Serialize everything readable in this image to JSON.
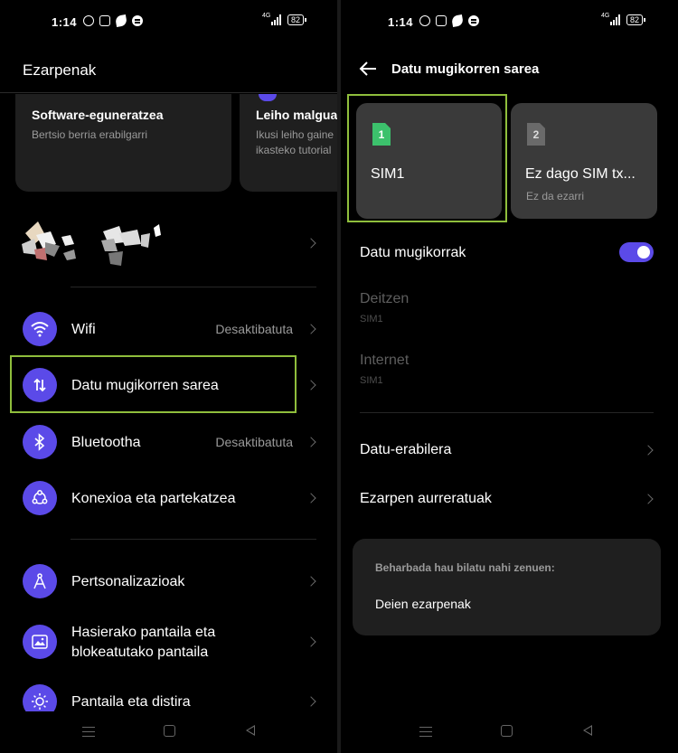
{
  "status": {
    "time": "1:14",
    "network": "4G",
    "battery": "82"
  },
  "left": {
    "title": "Ezarpenak",
    "cards": [
      {
        "title": "Software-eguneratzea",
        "subtitle": "Bertsio berria erabilgarri"
      },
      {
        "title": "Leiho malgual",
        "subtitle": "Ikusi leiho gaine ikasteko tutorial"
      }
    ],
    "items": [
      {
        "label": "Wifi",
        "value": "Desaktibatuta",
        "icon": "wifi-icon"
      },
      {
        "label": "Datu mugikorren sarea",
        "value": "",
        "icon": "data-transfer-icon"
      },
      {
        "label": "Bluetootha",
        "value": "Desaktibatuta",
        "icon": "bluetooth-icon"
      },
      {
        "label": "Konexioa eta partekatzea",
        "value": "",
        "icon": "share-icon"
      },
      {
        "label": "Pertsonalizazioak",
        "value": "",
        "icon": "personalize-icon"
      },
      {
        "label_line1": "Hasierako pantaila eta",
        "label_line2": "blokeatutako pantaila",
        "icon": "image-icon"
      },
      {
        "label": "Pantaila eta distira",
        "value": "",
        "icon": "brightness-icon"
      }
    ]
  },
  "right": {
    "title": "Datu mugikorren sarea",
    "sims": [
      {
        "chip": "1",
        "name": "SIM1",
        "sub": ""
      },
      {
        "chip": "2",
        "name": "Ez dago SIM tx...",
        "sub": "Ez da ezarri"
      }
    ],
    "mobile_data": {
      "label": "Datu mugikorrak",
      "enabled": true
    },
    "calls": {
      "label": "Deitzen",
      "sub": "SIM1"
    },
    "internet": {
      "label": "Internet",
      "sub": "SIM1"
    },
    "data_usage": "Datu-erabilera",
    "advanced": "Ezarpen aurreratuak",
    "suggest": {
      "heading": "Beharbada hau bilatu nahi zenuen:",
      "item": "Deien ezarpenak"
    }
  },
  "colors": {
    "accent": "#5b4ae8",
    "highlight": "#8fbe3c",
    "sim_green": "#3cc16c"
  }
}
